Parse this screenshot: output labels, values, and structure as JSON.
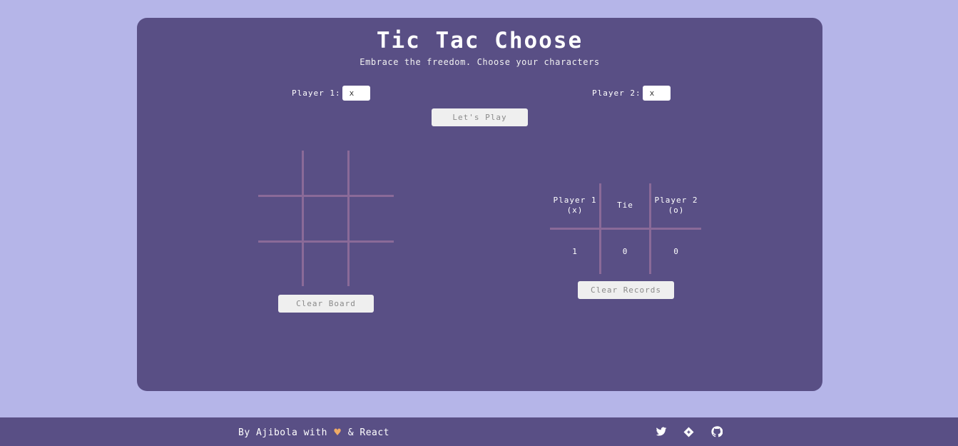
{
  "header": {
    "title": "Tic Tac Choose",
    "subtitle": "Embrace the freedom. Choose your characters"
  },
  "players": {
    "player1_label": "Player 1:",
    "player1_value": "x",
    "player2_label": "Player 2:",
    "player2_value": "x"
  },
  "actions": {
    "play_label": "Let's Play",
    "clear_board_label": "Clear Board",
    "clear_records_label": "Clear Records"
  },
  "board": {
    "cells": [
      "",
      "",
      "",
      "",
      "",
      "",
      "",
      "",
      ""
    ]
  },
  "records": {
    "player1_heading_line1": "Player 1",
    "player1_heading_line2": "(x)",
    "tie_heading": "Tie",
    "player2_heading_line1": "Player 2",
    "player2_heading_line2": "(o)",
    "player1_score": "1",
    "tie_score": "0",
    "player2_score": "0"
  },
  "footer": {
    "credit_prefix": "By Ajibola with",
    "credit_suffix": "& React",
    "heart_icon": "heart-icon",
    "links": [
      "twitter-icon",
      "gitlab-icon",
      "github-icon"
    ]
  },
  "colors": {
    "background": "#b5b5e8",
    "card": "#594f85",
    "grid_lines": "#8a6a98",
    "heart": "#eeaa66"
  }
}
